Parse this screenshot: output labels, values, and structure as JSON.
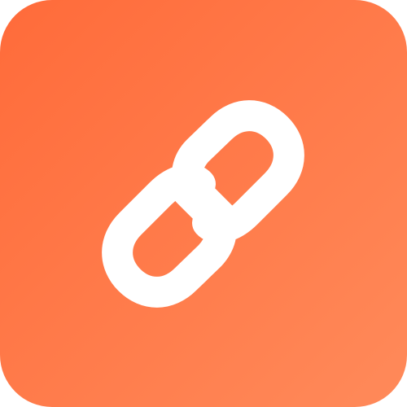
{
  "app_icon": {
    "name": "link",
    "icon": "link-icon",
    "colors": {
      "gradient_start": "#ff6b3a",
      "gradient_end": "#ff8a5a",
      "glyph": "#ffffff"
    }
  }
}
